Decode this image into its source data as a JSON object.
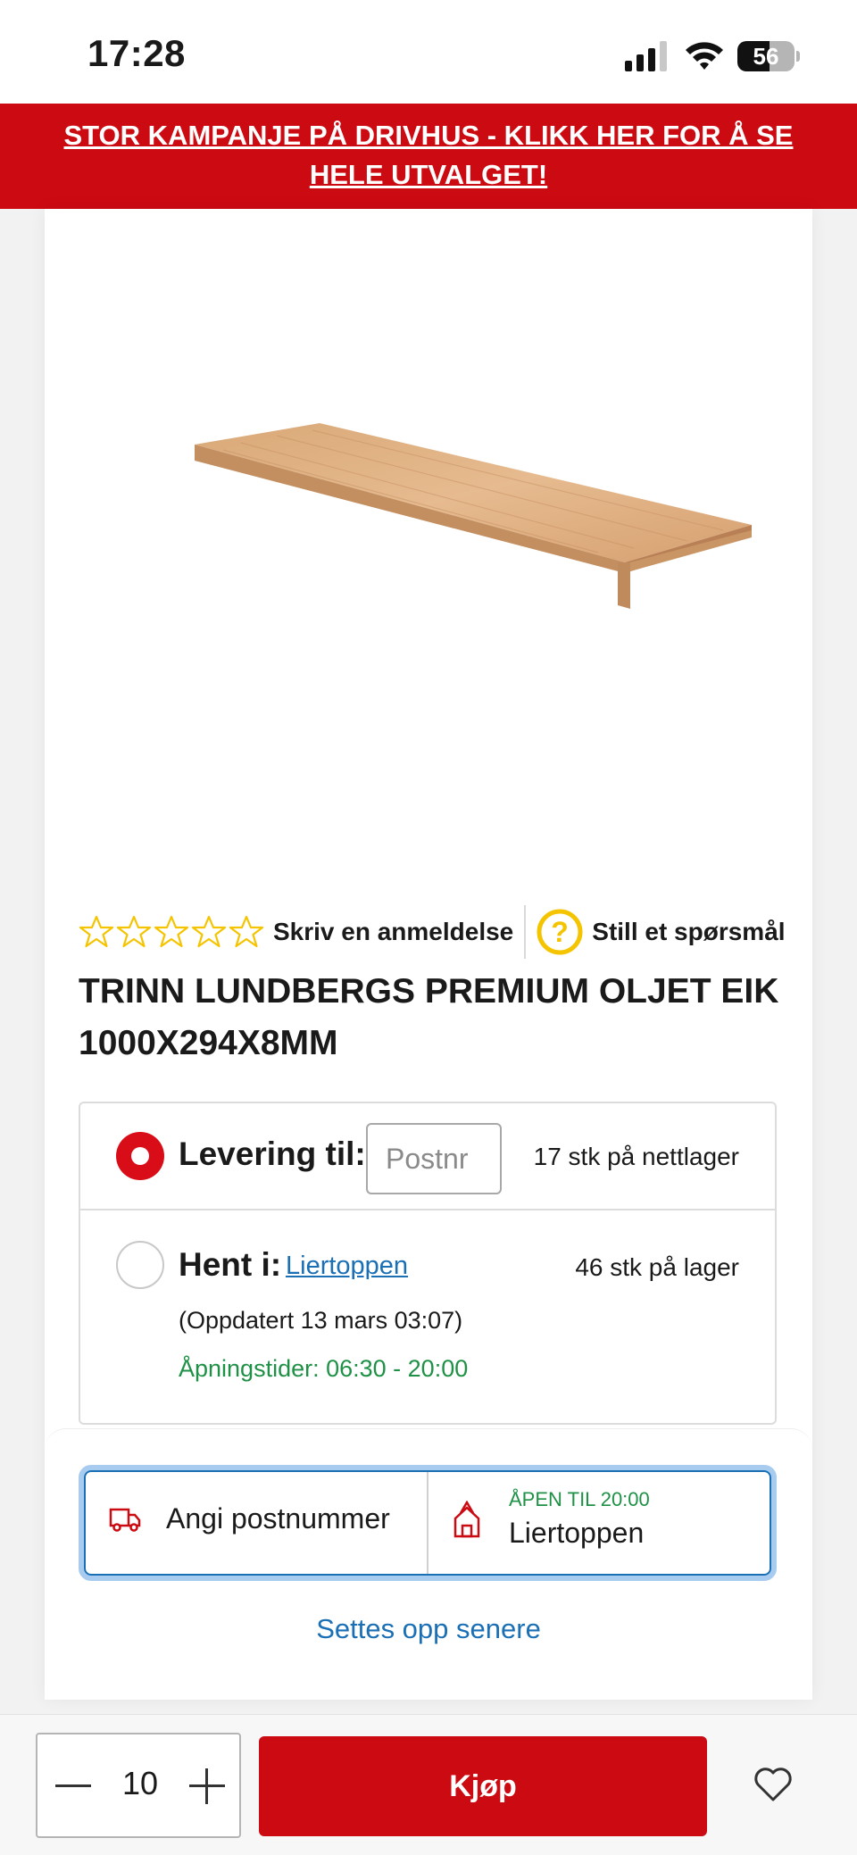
{
  "status_bar": {
    "time": "17:28",
    "battery": "56",
    "battery_level": 0.56
  },
  "promo_banner": {
    "text": "STOR KAMPANJE PÅ DRIVHUS - KLIKK HER FOR Å SE HELE UTVALGET!",
    "color": "#cc0a12"
  },
  "product": {
    "rating": 0,
    "max_rating": 5,
    "write_review": "Skriv en anmeldelse",
    "ask_question": "Still et spørsmål",
    "title": "TRINN LUNDBERGS PREMIUM OLJET EIK 1000X294X8MM"
  },
  "delivery": {
    "delivery_label": "Levering til:",
    "postnr_placeholder": "Postnr",
    "online_stock": "17 stk på nettlager",
    "pickup_label": "Hent i:",
    "store": "Liertoppen",
    "store_stock": "46 stk på lager",
    "updated": "(Oppdatert 13 mars 03:07)",
    "opening_hours": "Åpningstider: 06:30 - 20:00"
  },
  "picker": {
    "postnr_label": "Angi postnummer",
    "open_until": "ÅPEN TIL 20:00",
    "store_name": "Liertoppen",
    "later": "Settes opp senere"
  },
  "bottom_bar": {
    "quantity": "10",
    "buy_label": "Kjøp",
    "accent": "#cc0a12"
  },
  "icons": [
    "signal-icon",
    "wifi-icon",
    "battery-icon",
    "star-outline-icon",
    "question-icon",
    "truck-icon",
    "store-icon",
    "minus-icon",
    "plus-icon",
    "heart-icon"
  ]
}
